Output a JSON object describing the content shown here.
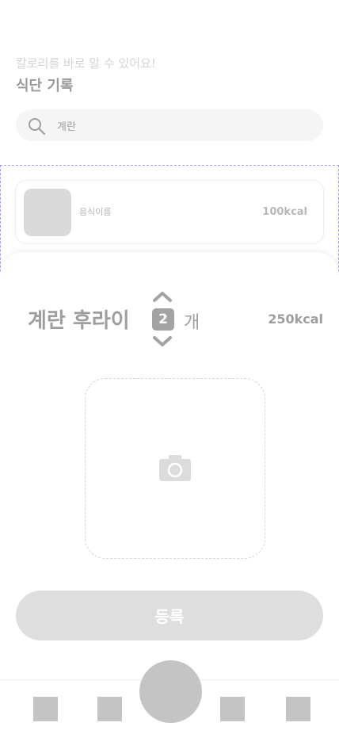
{
  "header": {
    "subtitle": "칼로리를 바로 알 수 있어요!",
    "title": "식단 기록"
  },
  "search": {
    "value": "계란",
    "icon": "search-icon"
  },
  "result_card": {
    "name": "음식이름",
    "kcal": "100kcal"
  },
  "sheet": {
    "food_name": "계란 후라이",
    "quantity": "2",
    "unit": "개",
    "kcal": "250kcal",
    "photo_icon": "camera-icon",
    "submit_label": "등록"
  },
  "bottom_nav": {
    "items": [
      "nav-item-1",
      "nav-item-2",
      "nav-center",
      "nav-item-3",
      "nav-item-4"
    ]
  }
}
